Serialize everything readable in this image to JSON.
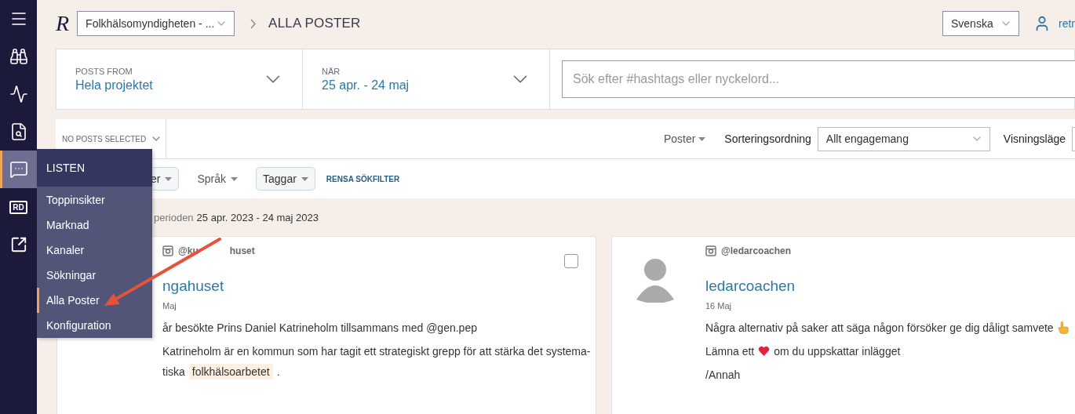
{
  "sidebar": {
    "items": [
      {
        "kind": "menu",
        "selected": false
      },
      {
        "kind": "binoculars",
        "selected": false
      },
      {
        "kind": "activity",
        "selected": false
      },
      {
        "kind": "search",
        "selected": false
      },
      {
        "kind": "chat",
        "selected": true
      },
      {
        "kind": "badge",
        "label": "RD",
        "selected": false
      },
      {
        "kind": "external",
        "selected": false
      }
    ]
  },
  "flyout": {
    "title": "LISTEN",
    "items": [
      {
        "label": "Toppinsikter",
        "selected": false
      },
      {
        "label": "Marknad",
        "selected": false
      },
      {
        "label": "Kanaler",
        "selected": false
      },
      {
        "label": "Sökningar",
        "selected": false
      },
      {
        "label": "Alla Poster",
        "selected": true
      },
      {
        "label": "Konfiguration",
        "selected": false
      }
    ]
  },
  "header": {
    "logo": "R",
    "project": "Folkhälsomyndigheten - ...",
    "breadcrumb": "ALLA POSTER",
    "language": "Svenska",
    "user": "retr"
  },
  "filters": {
    "source": {
      "label": "POSTS FROM",
      "value": "Hela projektet"
    },
    "period": {
      "label": "NÄR",
      "value": "25 apr. - 24 maj"
    },
    "search": {
      "placeholder": "Sök efter #hashtags eller nyckelord..."
    }
  },
  "toolbar": {
    "selection": "NO POSTS SELECTED",
    "type_menu": "Poster",
    "sort_label": "Sorteringsordning",
    "sort_value": "Allt engagemang",
    "view_label": "Visningsläge"
  },
  "filter_chips": [
    {
      "label": "er",
      "active": true
    },
    {
      "label": "Språk",
      "active": false
    },
    {
      "label": "Taggar",
      "active": true
    }
  ],
  "clear_filters": "RENSA SÖKFILTER",
  "period_note": {
    "label": "perioden",
    "value": "25 apr. 2023 - 24 maj 2023"
  },
  "posts": [
    {
      "handle": [
        "@ku",
        "huset"
      ],
      "name": "ngahuset",
      "date": "Maj",
      "checked": false,
      "paragraphs": [
        [
          [
            {
              "kind": "text",
              "text": "år besökte Prins Daniel Katrineholm tillsammans med @gen.pep"
            }
          ]
        ],
        [
          [
            {
              "kind": "text",
              "text": "Katrineholm är en kommun som har tagit ett strategiskt grepp för att stärka det systema-"
            }
          ],
          [
            {
              "kind": "text",
              "text": "tiska"
            },
            {
              "kind": "highlight",
              "text": "folkhälsoarbetet"
            },
            {
              "kind": "text",
              "text": "."
            }
          ]
        ]
      ]
    },
    {
      "avatar": true,
      "handle": [
        "@ledarcoachen"
      ],
      "name": "ledarcoachen",
      "date": "16 Maj",
      "paragraphs": [
        [
          [
            {
              "kind": "text",
              "text": "Några alternativ på saker att säga någon försöker ge dig dåligt samvete"
            },
            {
              "kind": "pointing"
            }
          ]
        ],
        [
          [
            {
              "kind": "text",
              "text": "Lämna ett"
            },
            {
              "kind": "heart"
            },
            {
              "kind": "text",
              "text": "om du uppskattar inlägget"
            }
          ]
        ],
        [
          [
            {
              "kind": "text",
              "text": "/Annah"
            }
          ]
        ]
      ]
    }
  ]
}
